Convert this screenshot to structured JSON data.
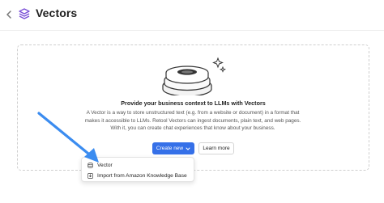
{
  "header": {
    "title": "Vectors",
    "back_icon": "chevron-left-icon",
    "app_icon": "vectors-stack-icon",
    "app_icon_color": "#7a4fd6"
  },
  "empty_state": {
    "illustration": "disc-stack-illustration",
    "heading": "Provide your business context to LLMs with Vectors",
    "description_lines": [
      "A Vector is a way to store unstructured text (e.g. from a website or document) in a format that",
      "makes it accessible to LLMs. Retool Vectors can ingest documents, plain text, and web pages.",
      "With it, you can create chat experiences that know about your business."
    ],
    "create_button_label": "Create new",
    "learn_more_label": "Learn more"
  },
  "dropdown": {
    "items": [
      {
        "label": "Vector",
        "icon": "database-icon"
      },
      {
        "label": "Import from Amazon Knowledge Base",
        "icon": "import-icon"
      }
    ]
  },
  "annotation": {
    "arrow_color": "#3b8cf0"
  },
  "colors": {
    "primary": "#3570e8",
    "border": "#cfcfcf"
  }
}
